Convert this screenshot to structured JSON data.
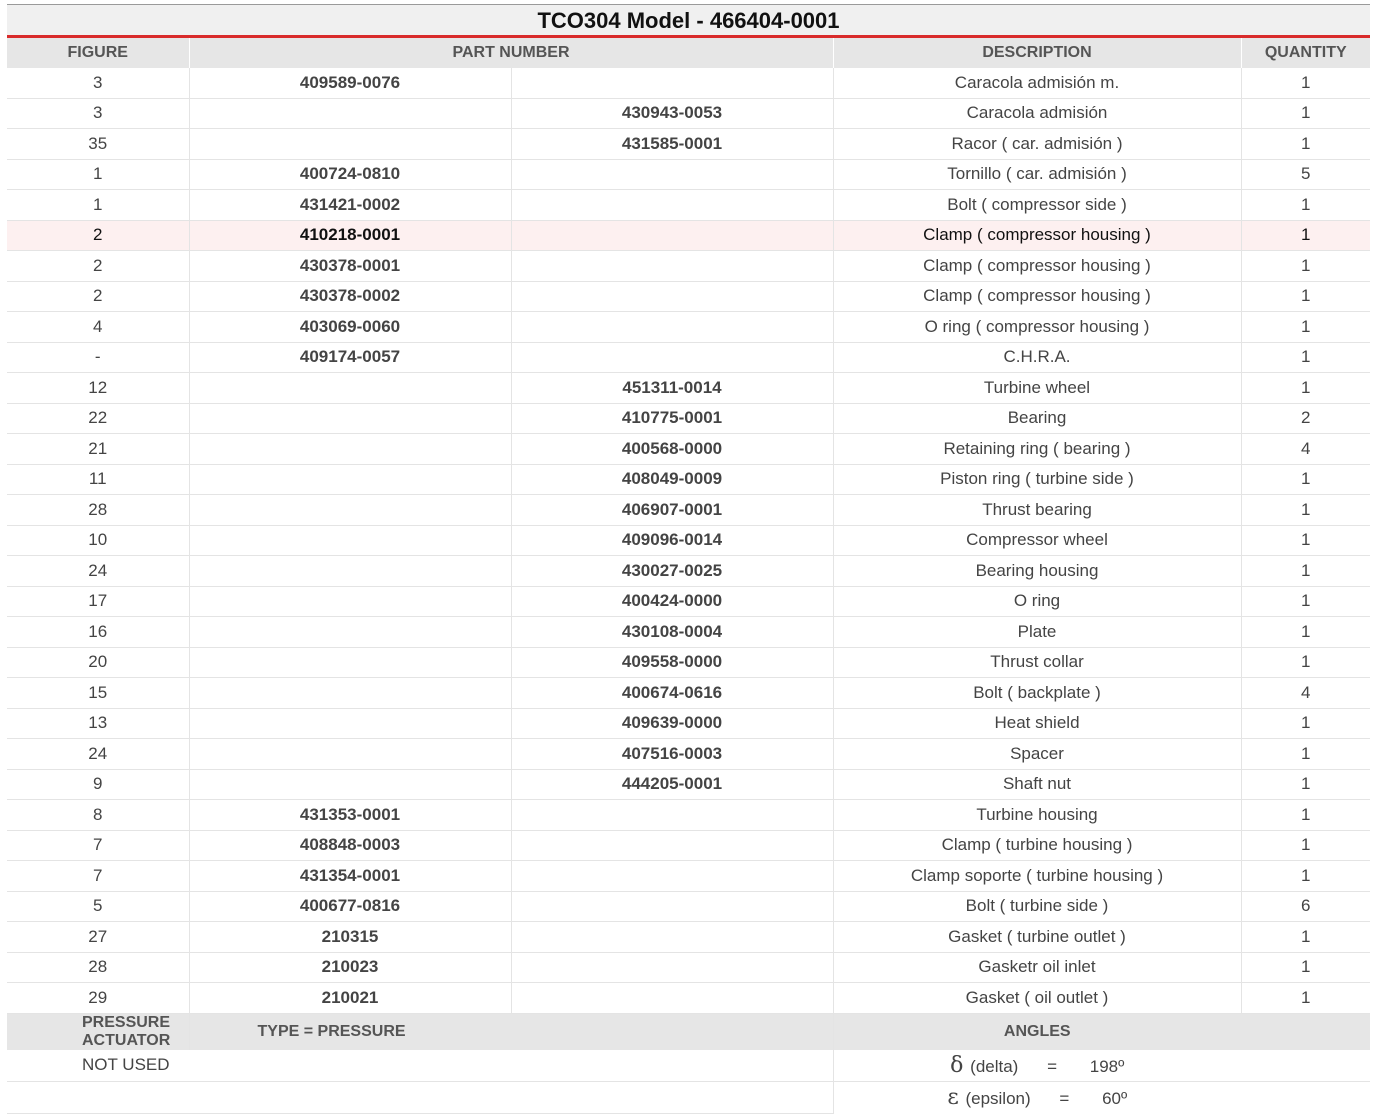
{
  "title": "TCO304 Model - 466404-0001",
  "headers": {
    "figure": "FIGURE",
    "part_number": "PART NUMBER",
    "description": "DESCRIPTION",
    "quantity": "QUANTITY"
  },
  "rows": [
    {
      "figure": "3",
      "pn1": "409589-0076",
      "pn2": "",
      "description": "Caracola admisión m.",
      "quantity": "1"
    },
    {
      "figure": "3",
      "pn1": "",
      "pn2": "430943-0053",
      "description": "Caracola admisión",
      "quantity": "1"
    },
    {
      "figure": "35",
      "pn1": "",
      "pn2": "431585-0001",
      "description": "Racor ( car. admisión )",
      "quantity": "1"
    },
    {
      "figure": "1",
      "pn1": "400724-0810",
      "pn2": "",
      "description": "Tornillo ( car. admisión )",
      "quantity": "5"
    },
    {
      "figure": "1",
      "pn1": "431421-0002",
      "pn2": "",
      "description": "Bolt ( compressor side )",
      "quantity": "1"
    },
    {
      "figure": "2",
      "pn1": "410218-0001",
      "pn2": "",
      "description": "Clamp ( compressor housing )",
      "quantity": "1",
      "highlight": true
    },
    {
      "figure": "2",
      "pn1": "430378-0001",
      "pn2": "",
      "description": "Clamp ( compressor housing )",
      "quantity": "1"
    },
    {
      "figure": "2",
      "pn1": "430378-0002",
      "pn2": "",
      "description": "Clamp ( compressor housing )",
      "quantity": "1"
    },
    {
      "figure": "4",
      "pn1": "403069-0060",
      "pn2": "",
      "description": "O ring ( compressor housing )",
      "quantity": "1"
    },
    {
      "figure": "-",
      "pn1": "409174-0057",
      "pn2": "",
      "description": "C.H.R.A.",
      "quantity": "1"
    },
    {
      "figure": "12",
      "pn1": "",
      "pn2": "451311-0014",
      "description": "Turbine wheel",
      "quantity": "1"
    },
    {
      "figure": "22",
      "pn1": "",
      "pn2": "410775-0001",
      "description": "Bearing",
      "quantity": "2"
    },
    {
      "figure": "21",
      "pn1": "",
      "pn2": "400568-0000",
      "description": "Retaining ring ( bearing )",
      "quantity": "4"
    },
    {
      "figure": "11",
      "pn1": "",
      "pn2": "408049-0009",
      "description": "Piston ring ( turbine side )",
      "quantity": "1"
    },
    {
      "figure": "28",
      "pn1": "",
      "pn2": "406907-0001",
      "description": "Thrust bearing",
      "quantity": "1"
    },
    {
      "figure": "10",
      "pn1": "",
      "pn2": "409096-0014",
      "description": "Compressor wheel",
      "quantity": "1"
    },
    {
      "figure": "24",
      "pn1": "",
      "pn2": "430027-0025",
      "description": "Bearing housing",
      "quantity": "1"
    },
    {
      "figure": "17",
      "pn1": "",
      "pn2": "400424-0000",
      "description": "O ring",
      "quantity": "1"
    },
    {
      "figure": "16",
      "pn1": "",
      "pn2": "430108-0004",
      "description": "Plate",
      "quantity": "1"
    },
    {
      "figure": "20",
      "pn1": "",
      "pn2": "409558-0000",
      "description": "Thrust collar",
      "quantity": "1"
    },
    {
      "figure": "15",
      "pn1": "",
      "pn2": "400674-0616",
      "description": "Bolt ( backplate )",
      "quantity": "4"
    },
    {
      "figure": "13",
      "pn1": "",
      "pn2": "409639-0000",
      "description": "Heat shield",
      "quantity": "1"
    },
    {
      "figure": "24",
      "pn1": "",
      "pn2": "407516-0003",
      "description": "Spacer",
      "quantity": "1"
    },
    {
      "figure": "9",
      "pn1": "",
      "pn2": "444205-0001",
      "description": "Shaft nut",
      "quantity": "1"
    },
    {
      "figure": "8",
      "pn1": "431353-0001",
      "pn2": "",
      "description": "Turbine housing",
      "quantity": "1"
    },
    {
      "figure": "7",
      "pn1": "408848-0003",
      "pn2": "",
      "description": "Clamp ( turbine housing )",
      "quantity": "1"
    },
    {
      "figure": "7",
      "pn1": "431354-0001",
      "pn2": "",
      "description": "Clamp soporte ( turbine housing )",
      "quantity": "1"
    },
    {
      "figure": "5",
      "pn1": "400677-0816",
      "pn2": "",
      "description": "Bolt ( turbine side )",
      "quantity": "6"
    },
    {
      "figure": "27",
      "pn1": "210315",
      "pn2": "",
      "description": "Gasket ( turbine outlet )",
      "quantity": "1"
    },
    {
      "figure": "28",
      "pn1": "210023",
      "pn2": "",
      "description": "Gasketr oil inlet",
      "quantity": "1"
    },
    {
      "figure": "29",
      "pn1": "210021",
      "pn2": "",
      "description": "Gasket ( oil outlet )",
      "quantity": "1"
    }
  ],
  "footer": {
    "actuator_label": "PRESSURE ACTUATOR",
    "type_label": "TYPE = PRESSURE",
    "angles_label": "ANGLES",
    "actuator_value": "NOT USED",
    "angles": [
      {
        "symbol": "δ",
        "name": "(delta)",
        "eq": "=",
        "value": "198º"
      },
      {
        "symbol": "ε",
        "name": "(epsilon)",
        "eq": "=",
        "value": "60º"
      }
    ]
  },
  "colors": {
    "accent": "#d92b2b",
    "header_bg": "#e6e6e6",
    "highlight_row": "#fdf0f0"
  }
}
